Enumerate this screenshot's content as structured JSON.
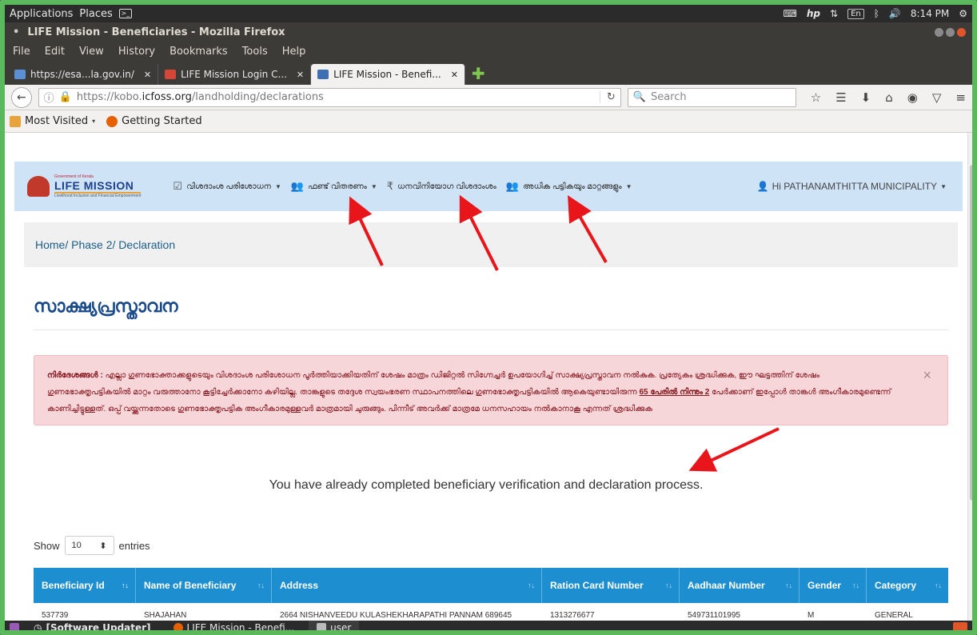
{
  "os_panel": {
    "applications": "Applications",
    "places": "Places",
    "time": "8:14 PM",
    "lang": "En"
  },
  "window": {
    "title": "LIFE Mission - Beneficiaries - Mozilla Firefox"
  },
  "menubar": [
    "File",
    "Edit",
    "View",
    "History",
    "Bookmarks",
    "Tools",
    "Help"
  ],
  "tabs": [
    {
      "label": "https://esa...la.gov.in/",
      "icon": "globe-icon"
    },
    {
      "label": "LIFE Mission Login C...",
      "icon": "gmail-icon"
    },
    {
      "label": "LIFE Mission - Benefi...",
      "icon": "life-mission-icon",
      "active": true
    }
  ],
  "navbar": {
    "url_prefix": "https://kobo.",
    "url_host": "icfoss.org",
    "url_path": "/landholding/declarations",
    "search_placeholder": "Search"
  },
  "bookmarks": [
    "Most Visited",
    "Getting Started"
  ],
  "site": {
    "logo_small": "Government of Kerala",
    "logo_big": "LIFE MISSION",
    "logo_sub": "Livelihood Inclusion and Financial Empowerment",
    "menus": [
      {
        "label": "വിശദാംശ പരിശോധന",
        "icon": "calendar-check-icon",
        "caret": true
      },
      {
        "label": "ഫണ്ട് വിതരണം",
        "icon": "users-icon",
        "caret": true
      },
      {
        "label": "ധനവിനിയോഗ വിശദാംശം",
        "icon": "rupee-icon",
        "caret": false
      },
      {
        "label": "അധിക പട്ടികയും മാറ്റങ്ങളും",
        "icon": "users-icon",
        "caret": true
      }
    ],
    "user": "Hi PATHANAMTHITTA MUNICIPALITY"
  },
  "breadcrumb": [
    "Home",
    "Phase 2",
    "Declaration"
  ],
  "page_title": "സാക്ഷ്യപ്രസ്താവന",
  "alert": {
    "label": "നിർദേശങ്ങൾ :",
    "text1": "എല്ലാ ഗുണഭോക്താക്കളുടെയും വിശദാംശ പരിശോധന പൂർത്തിയാക്കിയതിന് ശേഷം മാത്രം ഡിജിറ്റൽ സിഗ്നേച്ചർ ഉപയോഗിച്ച് സാക്ഷ്യപ്രസ്താവന നൽകുക. പ്രത്യേകം ശ്രദ്ധിക്കുക, ഈ ഘട്ടത്തിന് ശേഷം ഗുണഭോക്തൃപട്ടികയിൽ മാറ്റം വരുത്താനോ കൂട്ടിച്ചേർക്കാനോ കഴിയില്ല. താങ്കളുടെ തദ്ദേശ സ്വയംഭരണ സ്ഥാപനത്തിലെ ഗുണഭോക്തൃപട്ടികയിൽ ആകെയുണ്ടായിരുന്ന",
    "highlight": "65 പേരിൽ നിന്നും 2",
    "text2": "പേർക്കാണ് ഇപ്പോൾ താങ്കൾ അംഗീകാരമുണ്ടെന്ന് കാണിച്ചിട്ടുള്ളത്. ഒപ്പ് വയ്ക്കുന്നതോടെ ഗുണഭോക്തൃപട്ടിക അംഗീകാരമുള്ളവർ മാത്രമായി ചുരുങ്ങും. പിന്നീട് അവർക്ക് മാത്രമേ ധനസഹായം നൽകാനാകൂ എന്നത് ശ്രദ്ധിക്കുക",
    "close": "×"
  },
  "completed_message": "You have already completed beneficiary verification and declaration process.",
  "length_menu": {
    "show": "Show",
    "value": "10",
    "entries": "entries"
  },
  "table": {
    "columns": [
      "Beneficiary Id",
      "Name of Beneficiary",
      "Address",
      "Ration Card Number",
      "Aadhaar Number",
      "Gender",
      "Category"
    ],
    "rows": [
      [
        "537739",
        "SHAJAHAN",
        "2664 NISHANVEEDU KULASHEKHARAPATHI PANNAM 689645",
        "1313276677",
        "549731101995",
        "M",
        "GENERAL"
      ]
    ]
  },
  "taskbar": [
    {
      "label": "[Software Updater]",
      "icon": "updater-icon"
    },
    {
      "label": "LIFE Mission - Benefi...",
      "icon": "firefox-icon"
    },
    {
      "label": "user",
      "icon": "folder-icon"
    }
  ]
}
